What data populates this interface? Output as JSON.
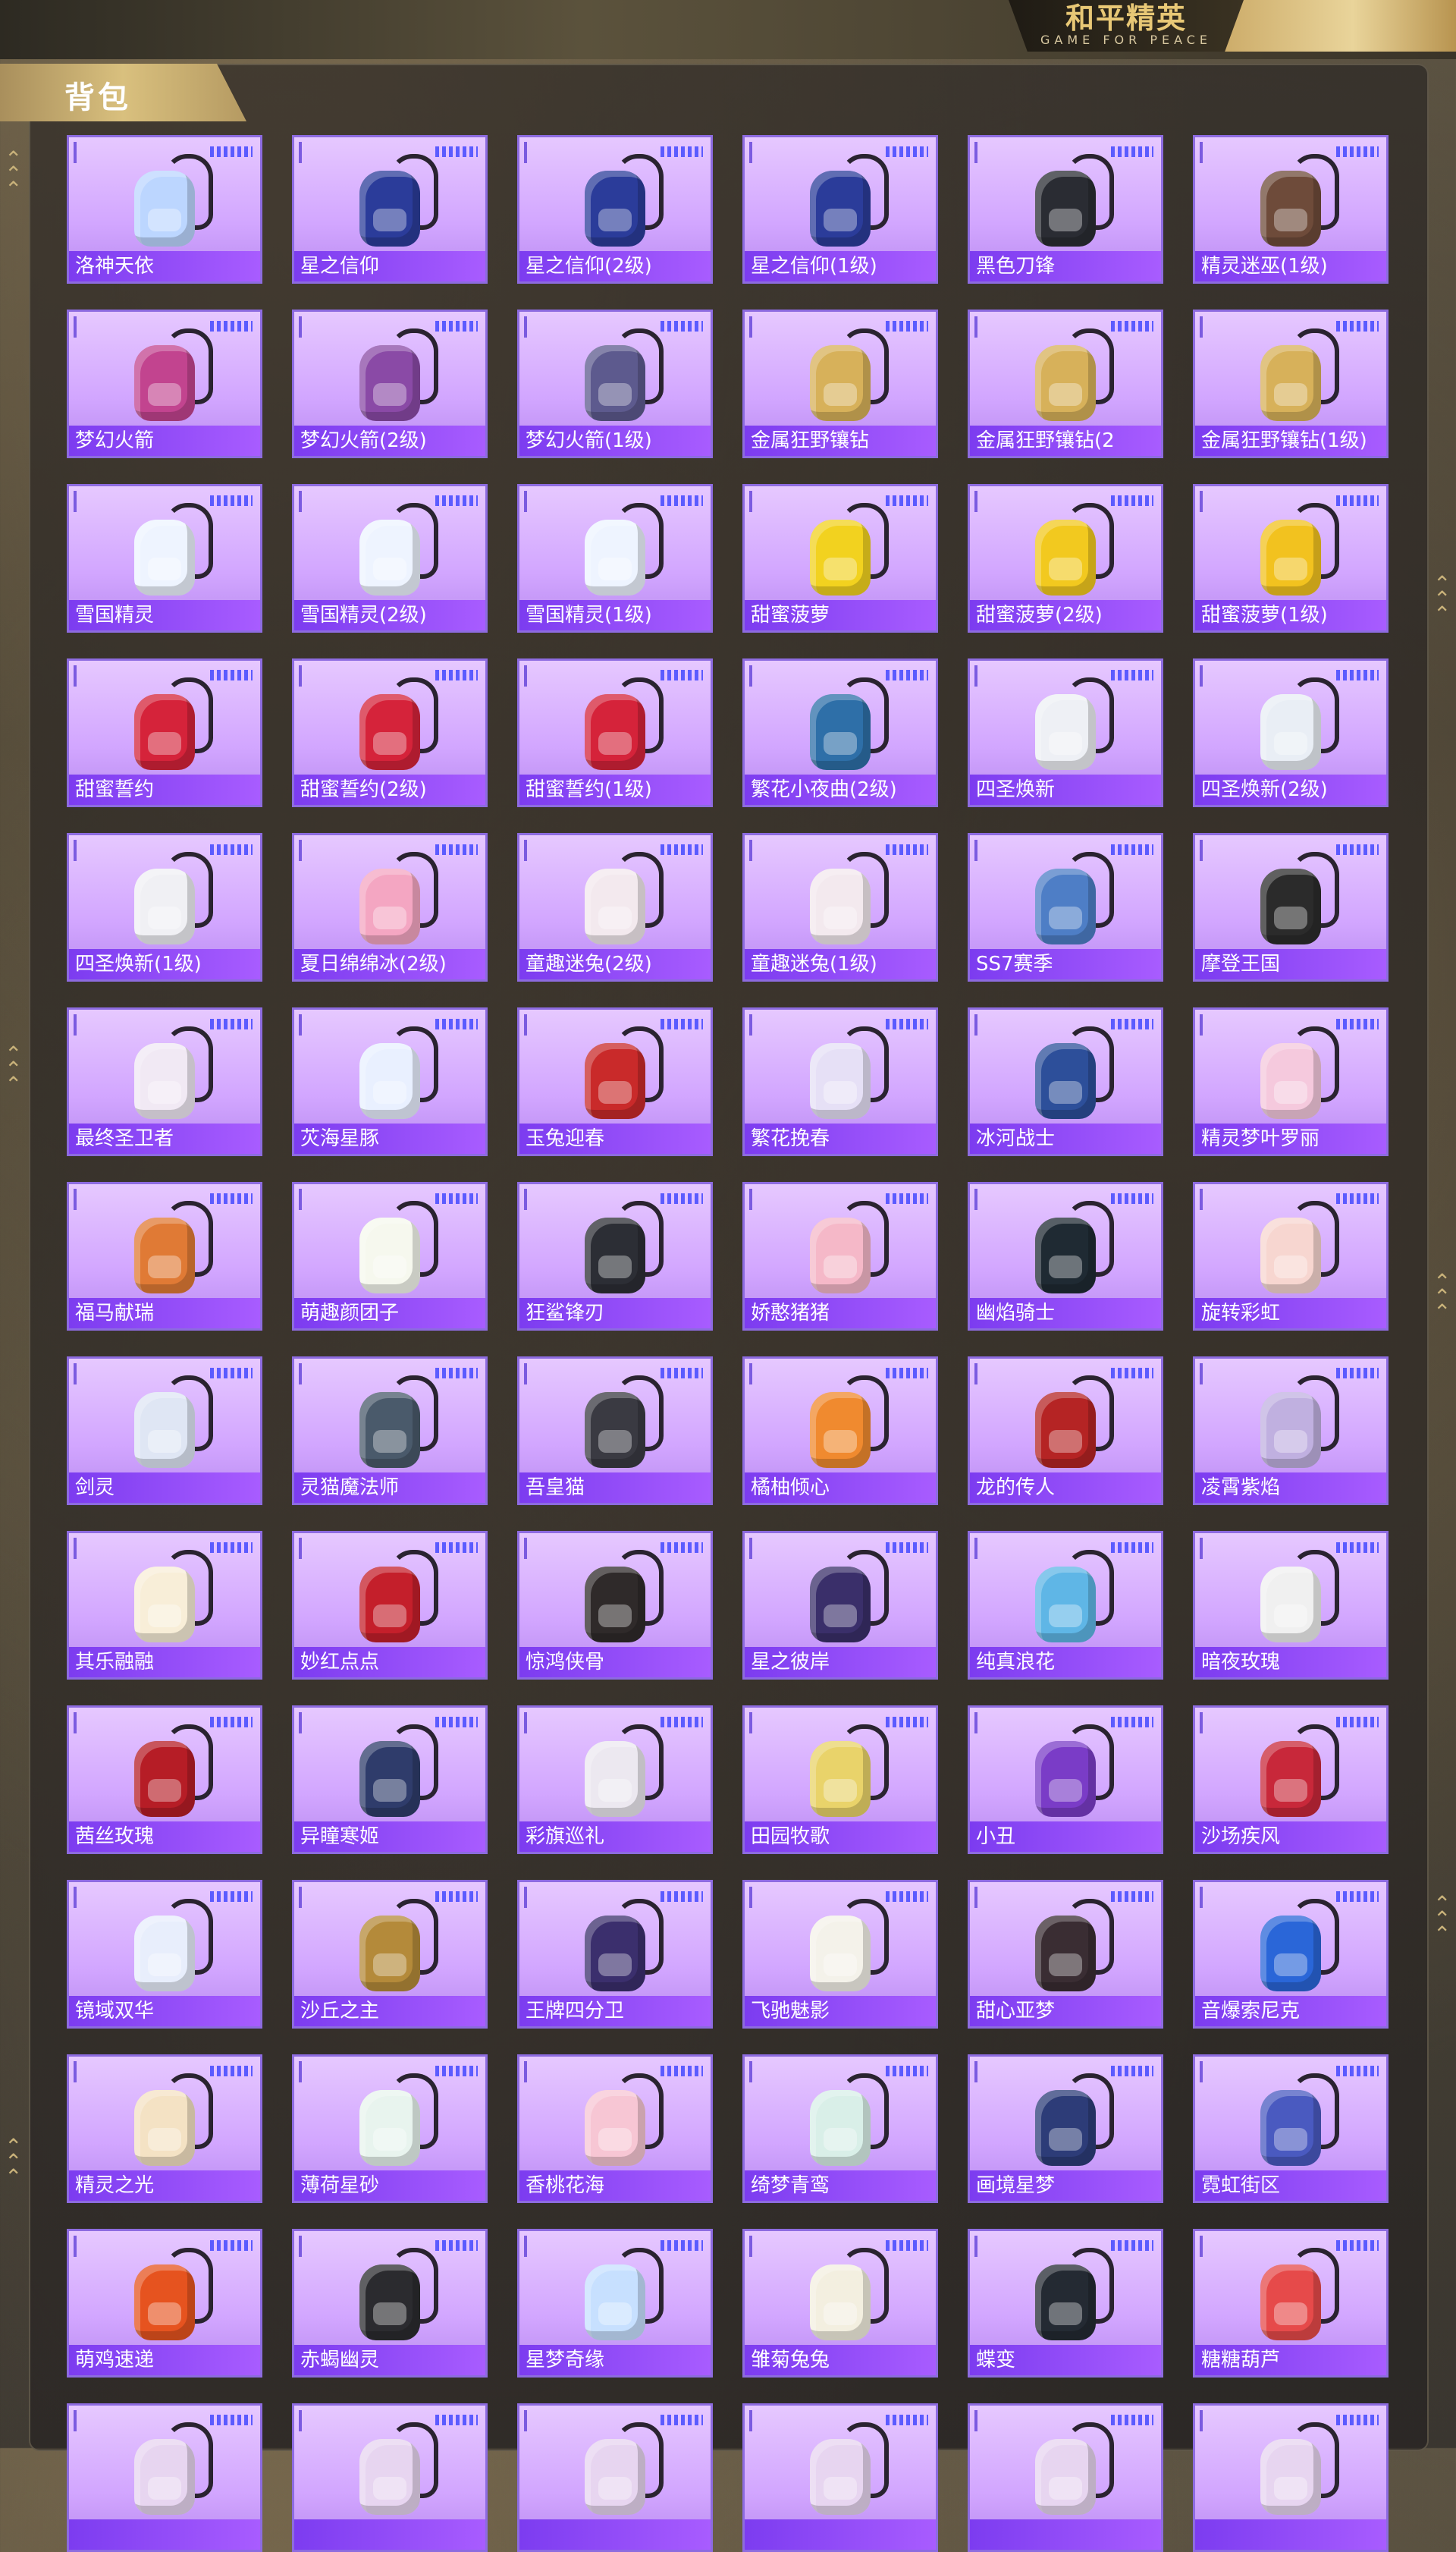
{
  "header": {
    "logo_main": "和平精英",
    "logo_sub": "GAME FOR PEACE",
    "tab_title": "背包"
  },
  "colors": {
    "card_bg": "#d2a6ff",
    "label_bar": "#8a45f5",
    "gold": "#d9c07e"
  },
  "grid": {
    "columns": 6,
    "items": [
      {
        "name": "洛神天依",
        "color": "#bcd6ff"
      },
      {
        "name": "星之信仰",
        "color": "#2b3c9a"
      },
      {
        "name": "星之信仰(2级)",
        "color": "#2b3c9a"
      },
      {
        "name": "星之信仰(1级)",
        "color": "#2b3c9a"
      },
      {
        "name": "黑色刀锋",
        "color": "#2a2c33"
      },
      {
        "name": "精灵迷巫(1级)",
        "color": "#6e4b3a"
      },
      {
        "name": "梦幻火箭",
        "color": "#c2448f"
      },
      {
        "name": "梦幻火箭(2级)",
        "color": "#8a4aa6"
      },
      {
        "name": "梦幻火箭(1级)",
        "color": "#5d5a8e"
      },
      {
        "name": "金属狂野镶钻",
        "color": "#d7b15a"
      },
      {
        "name": "金属狂野镶钻(2",
        "color": "#d7b15a"
      },
      {
        "name": "金属狂野镶钻(1级)",
        "color": "#d7b15a"
      },
      {
        "name": "雪国精灵",
        "color": "#eef4ff"
      },
      {
        "name": "雪国精灵(2级)",
        "color": "#eef4ff"
      },
      {
        "name": "雪国精灵(1级)",
        "color": "#eef4ff"
      },
      {
        "name": "甜蜜菠萝",
        "color": "#f2d21f"
      },
      {
        "name": "甜蜜菠萝(2级)",
        "color": "#f2c91f"
      },
      {
        "name": "甜蜜菠萝(1级)",
        "color": "#f2c21f"
      },
      {
        "name": "甜蜜誓约",
        "color": "#d5233a"
      },
      {
        "name": "甜蜜誓约(2级)",
        "color": "#d5233a"
      },
      {
        "name": "甜蜜誓约(1级)",
        "color": "#d5233a"
      },
      {
        "name": "繁花小夜曲(2级)",
        "color": "#2e6fa8"
      },
      {
        "name": "四圣焕新",
        "color": "#eef0f5"
      },
      {
        "name": "四圣焕新(2级)",
        "color": "#e9eef5"
      },
      {
        "name": "四圣焕新(1级)",
        "color": "#f0f0f4"
      },
      {
        "name": "夏日绵绵冰(2级)",
        "color": "#f4a6c2"
      },
      {
        "name": "童趣迷兔(2级)",
        "color": "#f3e9ee"
      },
      {
        "name": "童趣迷兔(1级)",
        "color": "#f3e9ee"
      },
      {
        "name": "SS7赛季",
        "color": "#4e7ec6"
      },
      {
        "name": "摩登王国",
        "color": "#2b2b2b"
      },
      {
        "name": "最终圣卫者",
        "color": "#f1e9f4"
      },
      {
        "name": "苂海星豚",
        "color": "#e9f0ff"
      },
      {
        "name": "玉兔迎春",
        "color": "#c92a2a"
      },
      {
        "name": "繁花挽春",
        "color": "#e6e0f6"
      },
      {
        "name": "冰河战士",
        "color": "#2d4f9a"
      },
      {
        "name": "精灵梦叶罗丽",
        "color": "#f5c9dd"
      },
      {
        "name": "福马献瑞",
        "color": "#e07a35"
      },
      {
        "name": "萌趣颜团子",
        "color": "#f6f8ee"
      },
      {
        "name": "狂鲨锋刃",
        "color": "#2c2e35"
      },
      {
        "name": "娇憨猪猪",
        "color": "#f5b8c8"
      },
      {
        "name": "幽焰骑士",
        "color": "#1f2a33"
      },
      {
        "name": "旋转彩虹",
        "color": "#f7d6d0"
      },
      {
        "name": "剑灵",
        "color": "#dfe6f4"
      },
      {
        "name": "灵猫魔法师",
        "color": "#4a5a6b"
      },
      {
        "name": "吾皇猫",
        "color": "#3a3a42"
      },
      {
        "name": "橘柚倾心",
        "color": "#f08a2f"
      },
      {
        "name": "龙的传人",
        "color": "#b52424"
      },
      {
        "name": "凌霄紫焰",
        "color": "#c0b0e0"
      },
      {
        "name": "其乐融融",
        "color": "#f8eed8"
      },
      {
        "name": "妙红点点",
        "color": "#c41f2b"
      },
      {
        "name": "惊鸿侠骨",
        "color": "#2f2a2a"
      },
      {
        "name": "星之彼岸",
        "color": "#3a2f6a"
      },
      {
        "name": "纯真浪花",
        "color": "#5fb6e6"
      },
      {
        "name": "暗夜玫瑰",
        "color": "#f0f0f0"
      },
      {
        "name": "茜丝玫瑰",
        "color": "#b61d26"
      },
      {
        "name": "异瞳寒姬",
        "color": "#2f3c6b"
      },
      {
        "name": "彩旗巡礼",
        "color": "#ece8f0"
      },
      {
        "name": "田园牧歌",
        "color": "#e9d36a"
      },
      {
        "name": "小丑",
        "color": "#7a3cc7"
      },
      {
        "name": "沙场疾风",
        "color": "#c8283a"
      },
      {
        "name": "镜域双华",
        "color": "#e8eefc"
      },
      {
        "name": "沙丘之主",
        "color": "#b48a3a"
      },
      {
        "name": "王牌四分卫",
        "color": "#3b2f6d"
      },
      {
        "name": "飞驰魅影",
        "color": "#f4f2ea"
      },
      {
        "name": "甜心亚梦",
        "color": "#3a2d33"
      },
      {
        "name": "音爆索尼克",
        "color": "#2a66d8"
      },
      {
        "name": "精灵之光",
        "color": "#f4e2c4"
      },
      {
        "name": "薄荷星砂",
        "color": "#e8f4ee"
      },
      {
        "name": "香桃花海",
        "color": "#f7c6d4"
      },
      {
        "name": "绮梦青鸾",
        "color": "#d9efe8"
      },
      {
        "name": "画境星梦",
        "color": "#2d3c78"
      },
      {
        "name": "霓虹街区",
        "color": "#4a5ac0"
      },
      {
        "name": "萌鸡速递",
        "color": "#e6531f"
      },
      {
        "name": "赤蝎幽灵",
        "color": "#2b2b2f"
      },
      {
        "name": "星梦奇缘",
        "color": "#c7e0ff"
      },
      {
        "name": "雏菊兔兔",
        "color": "#f3efe0"
      },
      {
        "name": "蝶变",
        "color": "#242a33"
      },
      {
        "name": "糖糖葫芦",
        "color": "#e64a4a"
      },
      {
        "name": "",
        "color": "#e7d5f0"
      },
      {
        "name": "",
        "color": "#e7d5f0"
      },
      {
        "name": "",
        "color": "#e7d5f0"
      },
      {
        "name": "",
        "color": "#e7d5f0"
      },
      {
        "name": "",
        "color": "#e7d5f0"
      },
      {
        "name": "",
        "color": "#e7d5f0"
      }
    ]
  }
}
